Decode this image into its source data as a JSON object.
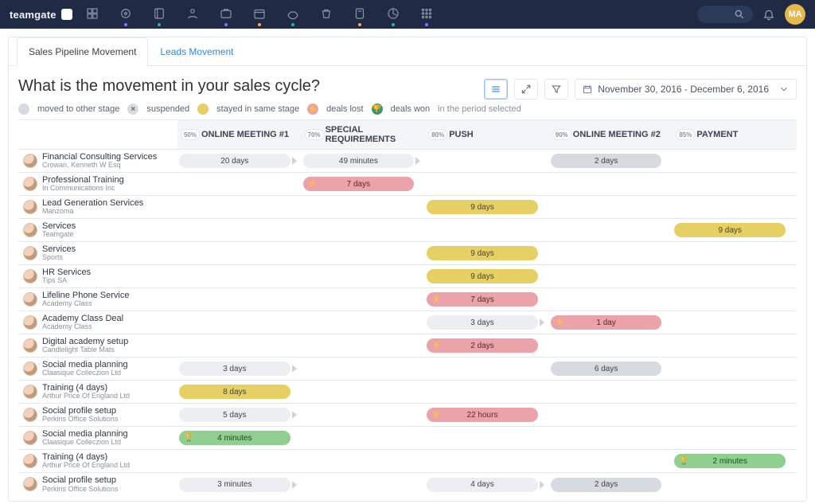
{
  "brand": {
    "name": "teamgate"
  },
  "nav_dots": [
    "",
    "#8a6cff",
    "#2fb3a0",
    "",
    "#8a6cff",
    "#f0b13a",
    "#2fb3a0",
    "",
    "#f0b13a",
    "#2fb3a0",
    "#8a6cff",
    ""
  ],
  "user": {
    "initials": "MA"
  },
  "tabs": [
    {
      "label": "Sales Pipeline Movement",
      "active": true
    },
    {
      "label": "Leads Movement",
      "active": false
    }
  ],
  "title": "What is the movement in your sales cycle?",
  "daterange": "November 30, 2016 - December 6, 2016",
  "legend": {
    "moved": "moved to other stage",
    "suspended": "suspended",
    "stayed": "stayed in same stage",
    "lost": "deals lost",
    "won": "deals won",
    "period": "in the period selected"
  },
  "stages": [
    {
      "pct": "50%",
      "name": "ONLINE MEETING #1"
    },
    {
      "pct": "70%",
      "name": "SPECIAL REQUIREMENTS"
    },
    {
      "pct": "80%",
      "name": "PUSH"
    },
    {
      "pct": "90%",
      "name": "ONLINE MEETING #2"
    },
    {
      "pct": "85%",
      "name": "PAYMENT"
    }
  ],
  "deals": [
    {
      "name": "Financial Consulting Services",
      "org": "Crowan, Kenneth W Esq",
      "bars": [
        {
          "stage": 0,
          "label": "20 days",
          "kind": "grey",
          "caret": true
        },
        {
          "stage": 1,
          "label": "49 minutes",
          "kind": "grey",
          "caret": true
        },
        {
          "stage": 3,
          "label": "2 days",
          "kind": "grey2"
        }
      ]
    },
    {
      "name": "Professional Training",
      "org": "In Communications Inc",
      "bars": [
        {
          "stage": 1,
          "label": "7 days",
          "kind": "pink",
          "glyph": "⚡"
        }
      ]
    },
    {
      "name": "Lead Generation Services",
      "org": "Manzoma",
      "bars": [
        {
          "stage": 2,
          "label": "9 days",
          "kind": "yellow"
        }
      ]
    },
    {
      "name": "Services",
      "org": "Teamgate",
      "bars": [
        {
          "stage": 4,
          "label": "9 days",
          "kind": "yellow"
        }
      ]
    },
    {
      "name": "Services",
      "org": "Sports",
      "bars": [
        {
          "stage": 2,
          "label": "9 days",
          "kind": "yellow"
        }
      ]
    },
    {
      "name": "HR Services",
      "org": "Tips SA",
      "bars": [
        {
          "stage": 2,
          "label": "9 days",
          "kind": "yellow"
        }
      ]
    },
    {
      "name": "Lifeline Phone Service",
      "org": "Academy Class",
      "bars": [
        {
          "stage": 2,
          "label": "7 days",
          "kind": "pink",
          "glyph": "⚡"
        }
      ]
    },
    {
      "name": "Academy Class Deal",
      "org": "Academy Class",
      "bars": [
        {
          "stage": 2,
          "label": "3 days",
          "kind": "grey",
          "caret": true
        },
        {
          "stage": 3,
          "label": "1 day",
          "kind": "pink",
          "glyph": "⚡"
        }
      ]
    },
    {
      "name": "Digital academy setup",
      "org": "Candlelight Table Mats",
      "bars": [
        {
          "stage": 2,
          "label": "2 days",
          "kind": "pink",
          "glyph": "⚡"
        }
      ]
    },
    {
      "name": "Social media planning",
      "org": "Claasique Colleczion Ltd",
      "bars": [
        {
          "stage": 0,
          "label": "3 days",
          "kind": "grey",
          "caret": true
        },
        {
          "stage": 3,
          "label": "6 days",
          "kind": "grey2"
        }
      ]
    },
    {
      "name": "Training (4 days)",
      "org": "Arthur Price Of England Ltd",
      "bars": [
        {
          "stage": 0,
          "label": "8 days",
          "kind": "yellow"
        }
      ]
    },
    {
      "name": "Social profile setup",
      "org": "Perkins Office Solutions",
      "bars": [
        {
          "stage": 0,
          "label": "5 days",
          "kind": "grey",
          "caret": true
        },
        {
          "stage": 2,
          "label": "22 hours",
          "kind": "pink",
          "glyph": "⚡"
        }
      ]
    },
    {
      "name": "Social media planning",
      "org": "Claasique Colleczion Ltd",
      "bars": [
        {
          "stage": 0,
          "label": "4 minutes",
          "kind": "green",
          "glyph": "🏆"
        }
      ]
    },
    {
      "name": "Training (4 days)",
      "org": "Arthur Price Of England Ltd",
      "bars": [
        {
          "stage": 4,
          "label": "2 minutes",
          "kind": "green",
          "glyph": "🏆"
        }
      ]
    },
    {
      "name": "Social profile setup",
      "org": "Perkins Office Solutions",
      "bars": [
        {
          "stage": 0,
          "label": "3 minutes",
          "kind": "grey",
          "caret": true
        },
        {
          "stage": 2,
          "label": "4 days",
          "kind": "grey",
          "caret": true
        },
        {
          "stage": 3,
          "label": "2 days",
          "kind": "grey2"
        }
      ]
    }
  ]
}
